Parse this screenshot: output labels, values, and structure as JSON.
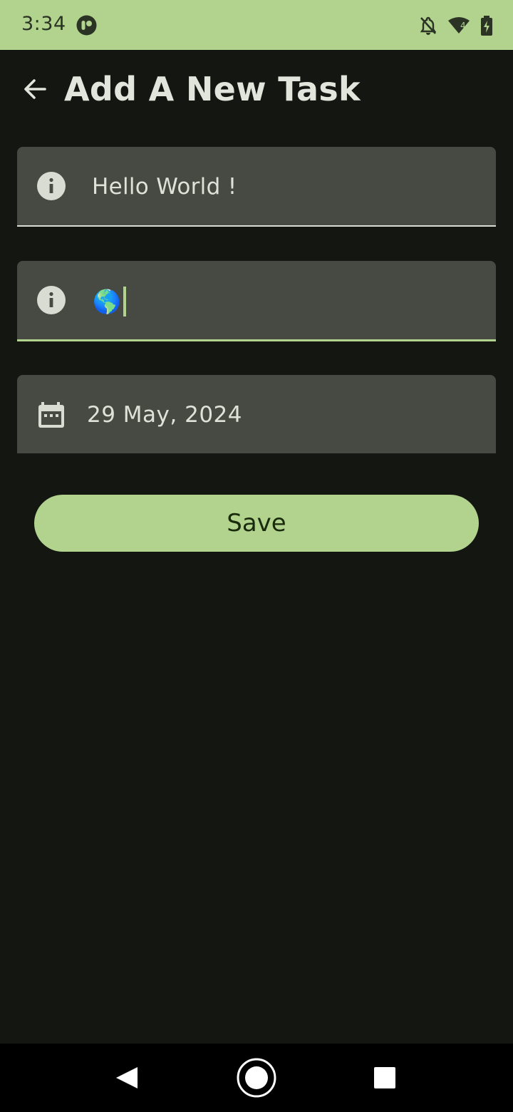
{
  "status_bar": {
    "time": "3:34",
    "icons": [
      "app-notification-icon",
      "notifications-off-icon",
      "wifi-icon",
      "battery-charging-icon"
    ],
    "wifi_badge": "4"
  },
  "app_bar": {
    "title": "Add A New Task",
    "back_icon": "arrow-back-icon"
  },
  "form": {
    "title_field": {
      "value": "Hello World !",
      "icon": "info-icon"
    },
    "description_field": {
      "value": "🌎",
      "icon": "info-icon",
      "focused": true
    },
    "date_field": {
      "value": "29 May, 2024",
      "icon": "calendar-icon"
    }
  },
  "actions": {
    "save_label": "Save"
  },
  "nav_bar": {
    "icons": [
      "nav-back-icon",
      "nav-home-icon",
      "nav-recents-icon"
    ]
  },
  "colors": {
    "accent": "#b2d38d",
    "background": "#141612",
    "field_bg": "#474a42",
    "on_accent": "#1a2a0c"
  }
}
